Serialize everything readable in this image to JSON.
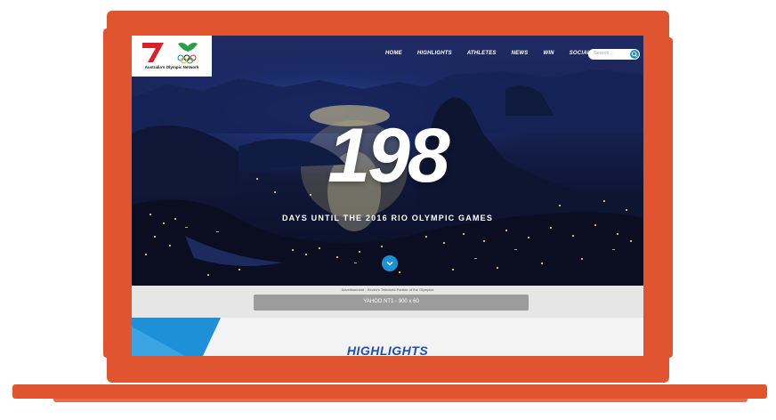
{
  "logo": {
    "tagline": "Australia's Olympic Network"
  },
  "nav": {
    "items": [
      "HOME",
      "HIGHLIGHTS",
      "ATHLETES",
      "NEWS",
      "WIN",
      "SOCIAL"
    ]
  },
  "search": {
    "placeholder": "Search..."
  },
  "hero": {
    "count": "198",
    "subtitle": "DAYS UNTIL THE 2016 RIO OLYMPIC GAMES"
  },
  "ad": {
    "label": "Advertisement - Seven's Televised Partner of the Olympics",
    "slot": "YAHOO NT1 - 900 x 60"
  },
  "highlights": {
    "title": "HIGHLIGHTS"
  },
  "colors": {
    "frame": "#e0552f",
    "accent_blue": "#1e90d8",
    "headline_blue": "#1f4fb5"
  }
}
